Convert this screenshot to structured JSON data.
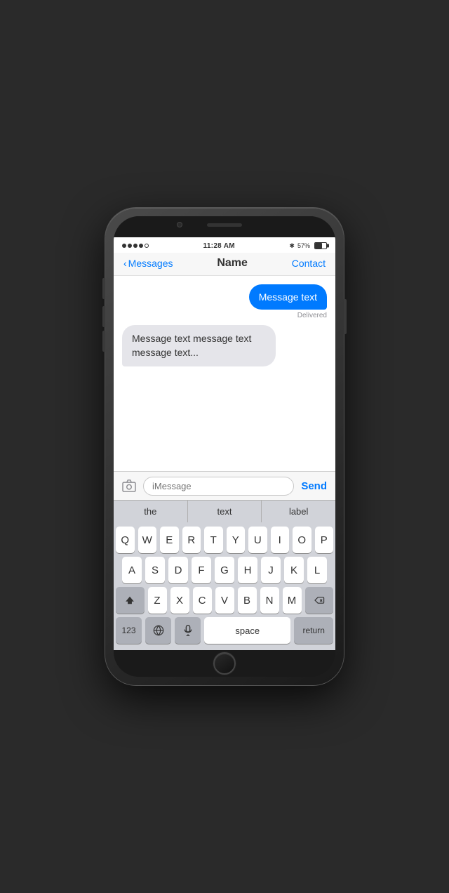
{
  "phone": {
    "status_bar": {
      "time": "11:28 AM",
      "battery_percent": "57%",
      "bluetooth": "✱"
    },
    "nav": {
      "back_label": "Messages",
      "title": "Name",
      "contact_label": "Contact"
    },
    "messages": [
      {
        "type": "sent",
        "text": "Message text",
        "status": "Delivered"
      },
      {
        "type": "received",
        "text": "Message text message text message text..."
      }
    ],
    "input": {
      "placeholder": "iMessage",
      "send_label": "Send"
    },
    "autocomplete": [
      "the",
      "text",
      "label"
    ],
    "keyboard": {
      "rows": [
        [
          "Q",
          "W",
          "E",
          "R",
          "T",
          "Y",
          "U",
          "I",
          "O",
          "P"
        ],
        [
          "A",
          "S",
          "D",
          "F",
          "G",
          "H",
          "J",
          "K",
          "L"
        ],
        [
          "Z",
          "X",
          "C",
          "V",
          "B",
          "N",
          "M"
        ]
      ],
      "bottom": [
        "123",
        "🌐",
        "🎤",
        "space",
        "return"
      ]
    }
  }
}
